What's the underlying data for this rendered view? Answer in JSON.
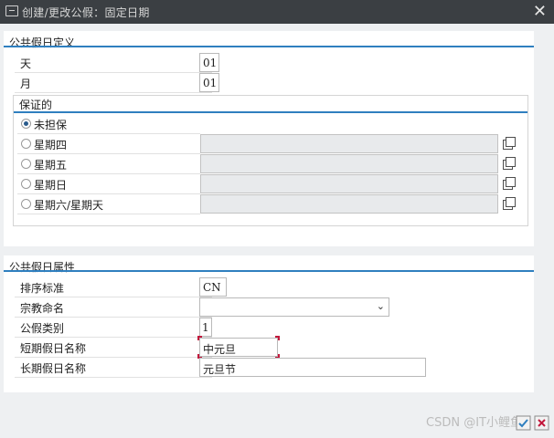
{
  "window": {
    "title": "创建/更改公假：固定日期",
    "close_glyph": "✕"
  },
  "definition_panel": {
    "title": "公共假日定义",
    "day": {
      "label": "天",
      "value": "01"
    },
    "month": {
      "label": "月",
      "value": "01"
    },
    "guarantee_group": {
      "title": "保证的",
      "options": [
        {
          "label": "未担保",
          "selected": true,
          "has_field": false
        },
        {
          "label": "星期四",
          "selected": false,
          "has_field": true
        },
        {
          "label": "星期五",
          "selected": false,
          "has_field": true
        },
        {
          "label": "星期日",
          "selected": false,
          "has_field": true
        },
        {
          "label": "星期六/星期天",
          "selected": false,
          "has_field": true
        }
      ]
    }
  },
  "attributes_panel": {
    "title": "公共假日属性",
    "sort_key": {
      "label": "排序标准",
      "value": "CN"
    },
    "religion": {
      "label": "宗教命名",
      "value": ""
    },
    "holiday_class": {
      "label": "公假类别",
      "value": "1"
    },
    "short_name": {
      "label": "短期假日名称",
      "value": "中元旦"
    },
    "long_name": {
      "label": "长期假日名称",
      "value": "元旦节"
    }
  },
  "watermark": "CSDN @IT小鲤鱼",
  "colors": {
    "accent": "#2f7fbf",
    "titlebar": "#3b3f43",
    "focus": "#c2183c"
  }
}
